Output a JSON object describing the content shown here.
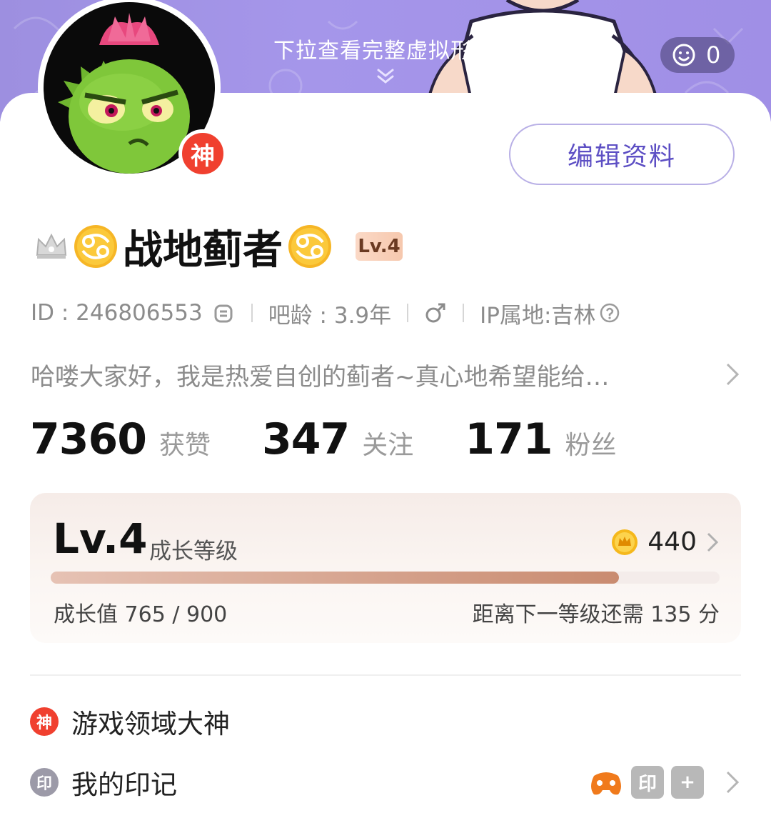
{
  "banner": {
    "hint": "下拉查看完整虚拟形象",
    "reaction_count": "0"
  },
  "profile": {
    "god_badge": "神",
    "edit_label": "编辑资料",
    "username": "战地蓟者",
    "level_tag": "Lv.4",
    "id_text": "ID : 246806553",
    "age_text": "吧龄 : 3.9年",
    "ip_text": "IP属地:吉林",
    "bio": "哈喽大家好，我是热爱自创的蓟者~真心地希望能给…"
  },
  "stats": [
    {
      "num": "7360",
      "label": "获赞"
    },
    {
      "num": "347",
      "label": "关注"
    },
    {
      "num": "171",
      "label": "粉丝"
    }
  ],
  "level": {
    "title": "Lv.4",
    "label": "成长等级",
    "coins": "440",
    "growth_text": "成长值 765 / 900",
    "remain_text": "距离下一等级还需 135 分",
    "progress": 0.85
  },
  "list": {
    "god_icon": "神",
    "god_label": "游戏领域大神",
    "mark_icon": "印",
    "mark_label": "我的印记",
    "mark_tiles": [
      "印",
      "+"
    ]
  },
  "colors": {
    "banner": "#a596ea",
    "accent": "#5d4fc4",
    "god_red": "#f0402f",
    "progress_fill": "#c98b70"
  },
  "icons": [
    "smile-icon",
    "chevron-down-icon",
    "crown-icon",
    "cancer-zodiac-icon",
    "copy-icon",
    "male-icon",
    "help-icon",
    "chevron-right-icon",
    "coin-icon"
  ]
}
